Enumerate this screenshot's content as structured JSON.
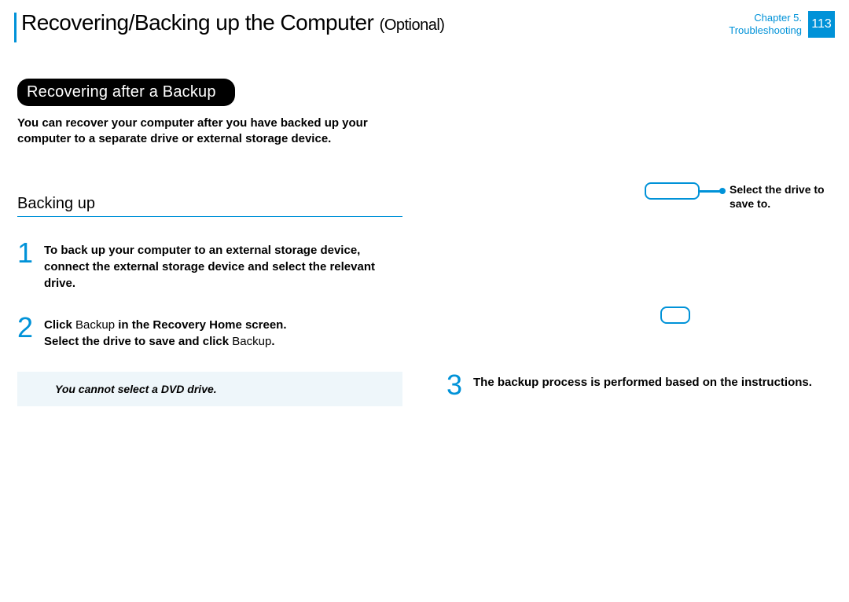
{
  "header": {
    "title_main": "Recovering/Backing up the Computer ",
    "title_optional": "(Optional)",
    "chapter_line1": "Chapter 5.",
    "chapter_line2": "Troubleshooting",
    "page_number": "113"
  },
  "left": {
    "section_pill": "Recovering after a Backup",
    "intro": "You can recover your computer after you have backed up your computer to a separate drive or external storage device.",
    "sub_heading": "Backing up",
    "step1_num": "1",
    "step1_body": "To back up your computer to an external storage device, connect the external storage device and select the relevant drive.",
    "step2_num": "2",
    "step2_body_a": "Click ",
    "step2_body_b": "Backup",
    "step2_body_c": " in the Recovery Home screen.",
    "step2_body_d": "Select the drive to save and click ",
    "step2_body_e": "Backup",
    "step2_body_f": ".",
    "note": "You cannot select a DVD drive."
  },
  "right": {
    "callout_label": "Select the drive to save to.",
    "step3_num": "3",
    "step3_body": "The backup process is performed based on the instructions."
  }
}
